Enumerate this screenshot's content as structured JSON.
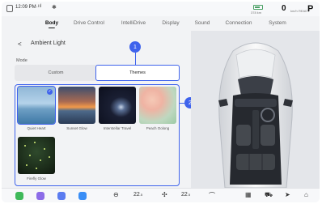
{
  "status_bar": {
    "time": "12:09 PM",
    "signal": ".ııl",
    "bt_glyph": "✱",
    "range": "378 km",
    "speed": "0",
    "speed_unit": "km/h",
    "ready": "READY",
    "gear": "P"
  },
  "tabs": [
    "Body",
    "Drive Control",
    "IntelliDrive",
    "Display",
    "Sound",
    "Connection",
    "System"
  ],
  "active_tab": "Body",
  "page": {
    "back_glyph": "<",
    "title": "Ambient Light"
  },
  "mode": {
    "label": "Mode",
    "options": [
      "Custom",
      "Themes"
    ],
    "selected": "Themes"
  },
  "themes": [
    {
      "name": "Quiet Heart",
      "selected": true
    },
    {
      "name": "Sunset Glow",
      "selected": false
    },
    {
      "name": "Interstellar Travel",
      "selected": false
    },
    {
      "name": "Peach Oolong",
      "selected": false
    },
    {
      "name": "Firefly Glow",
      "selected": false
    }
  ],
  "callouts": [
    "1",
    "2"
  ],
  "dock": {
    "left_temp": "22",
    "left_temp_dec": ".5",
    "right_temp": "22",
    "right_temp_dec": ".5",
    "app_colors": [
      "#3fb95a",
      "#8c6ce8",
      "#5b7cf0",
      "#3a8ef6"
    ]
  },
  "colors": {
    "accent": "#3f63ec",
    "background": "#f2f3f5"
  }
}
